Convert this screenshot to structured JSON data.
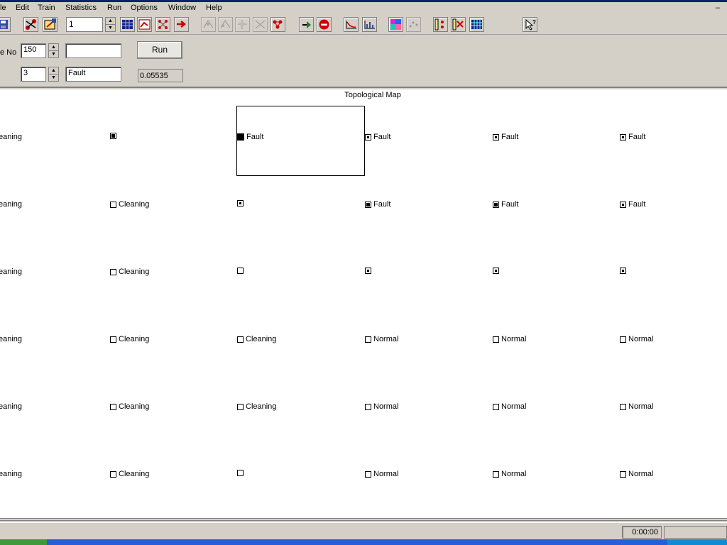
{
  "menu": [
    "le",
    "Edit",
    "Train",
    "Statistics",
    "Run",
    "Options",
    "Window",
    "Help"
  ],
  "window_min": "–",
  "toolbar": {
    "spin_value": "1"
  },
  "panel": {
    "node_label": "e No",
    "node_value": "150",
    "node_text": "",
    "second_value": "3",
    "second_text": "Fault",
    "run_label": "Run",
    "result": "0.05535"
  },
  "map": {
    "title": "Topological Map",
    "rows": [
      [
        {
          "marker": "none",
          "label": "eaning"
        },
        {
          "marker": "big",
          "label": ""
        },
        {
          "marker": "full",
          "label": "Fault"
        },
        {
          "marker": "dot",
          "label": "Fault"
        },
        {
          "marker": "dot",
          "label": "Fault"
        },
        {
          "marker": "dot",
          "label": "Fault"
        }
      ],
      [
        {
          "marker": "none",
          "label": "eaning"
        },
        {
          "marker": "empty",
          "label": "Cleaning"
        },
        {
          "marker": "dot",
          "label": ""
        },
        {
          "marker": "big",
          "label": "Fault"
        },
        {
          "marker": "big",
          "label": "Fault"
        },
        {
          "marker": "dot",
          "label": "Fault"
        }
      ],
      [
        {
          "marker": "none",
          "label": "eaning"
        },
        {
          "marker": "empty",
          "label": "Cleaning"
        },
        {
          "marker": "empty",
          "label": ""
        },
        {
          "marker": "dot",
          "label": ""
        },
        {
          "marker": "dot",
          "label": ""
        },
        {
          "marker": "dot",
          "label": ""
        }
      ],
      [
        {
          "marker": "none",
          "label": "eaning"
        },
        {
          "marker": "empty",
          "label": "Cleaning"
        },
        {
          "marker": "empty",
          "label": "Cleaning"
        },
        {
          "marker": "empty",
          "label": "Normal"
        },
        {
          "marker": "empty",
          "label": "Normal"
        },
        {
          "marker": "empty",
          "label": "Normal"
        }
      ],
      [
        {
          "marker": "none",
          "label": "eaning"
        },
        {
          "marker": "empty",
          "label": "Cleaning"
        },
        {
          "marker": "empty",
          "label": "Cleaning"
        },
        {
          "marker": "empty",
          "label": "Normal"
        },
        {
          "marker": "empty",
          "label": "Normal"
        },
        {
          "marker": "empty",
          "label": "Normal"
        }
      ],
      [
        {
          "marker": "none",
          "label": "eaning"
        },
        {
          "marker": "empty",
          "label": "Cleaning"
        },
        {
          "marker": "empty",
          "label": ""
        },
        {
          "marker": "empty",
          "label": "Normal"
        },
        {
          "marker": "empty",
          "label": "Normal"
        },
        {
          "marker": "empty",
          "label": "Normal"
        }
      ]
    ]
  },
  "status": {
    "timer": "0:00:00"
  },
  "icons": [
    "save-icon",
    "network-train-icon",
    "edit-network-icon",
    "grid-view-icon",
    "chart-view-icon",
    "neurons-icon",
    "export-icon",
    "layer1-icon",
    "layer2-icon",
    "layer3-icon",
    "layer4-icon",
    "cluster-icon",
    "run-icon",
    "stop-icon",
    "error-graph-icon",
    "histogram-icon",
    "color-map-icon",
    "scatter-icon",
    "window-a-icon",
    "window-b-icon",
    "window-c-icon",
    "help-pointer-icon"
  ]
}
